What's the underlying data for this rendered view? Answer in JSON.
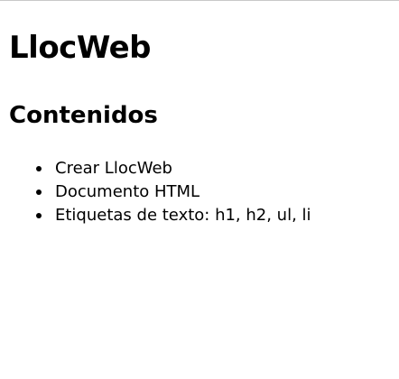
{
  "page": {
    "title": "LlocWeb",
    "section_heading": "Contenidos"
  },
  "contents": {
    "items": [
      "Crear LlocWeb",
      "Documento HTML",
      "Etiquetas de texto: h1, h2, ul, li"
    ]
  }
}
